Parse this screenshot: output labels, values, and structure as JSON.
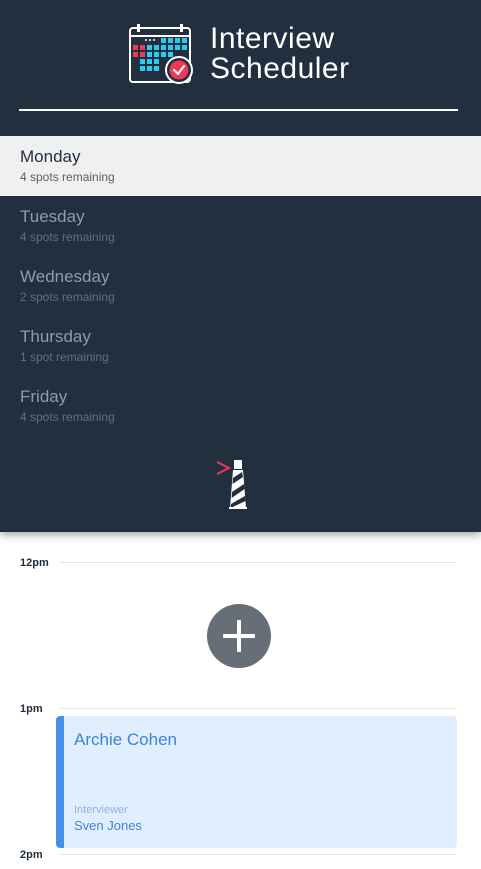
{
  "brand": {
    "title_line1": "Interview",
    "title_line2": "Scheduler",
    "logo_icon": "calendar-check-icon"
  },
  "days": [
    {
      "name": "Monday",
      "spots": "4 spots remaining",
      "selected": true
    },
    {
      "name": "Tuesday",
      "spots": "4 spots remaining",
      "selected": false
    },
    {
      "name": "Wednesday",
      "spots": "2 spots remaining",
      "selected": false
    },
    {
      "name": "Thursday",
      "spots": "1 spot remaining",
      "selected": false
    },
    {
      "name": "Friday",
      "spots": "4 spots remaining",
      "selected": false
    }
  ],
  "footer_icon": "lighthouse-icon",
  "schedule": {
    "times": [
      "12pm",
      "1pm",
      "2pm"
    ],
    "add_icon": "plus-icon",
    "appointment": {
      "student": "Archie Cohen",
      "interviewer_label": "Interviewer",
      "interviewer": "Sven Jones"
    }
  },
  "colors": {
    "sidebar_bg": "#222f3e",
    "selected_bg": "#f0f0f0",
    "appointment_bg": "#e1eefe",
    "appointment_accent": "#4a8fe7",
    "add_button": "#666f78",
    "alert_red": "#ee3856",
    "calendar_cyan": "#2ec9ee"
  }
}
